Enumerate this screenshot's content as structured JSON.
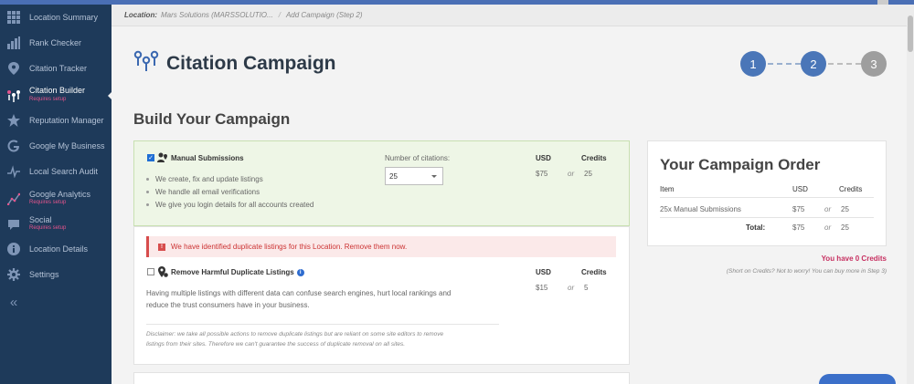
{
  "sidebar": {
    "items": [
      {
        "label": "Location Summary",
        "icon": "grid-icon",
        "sub": ""
      },
      {
        "label": "Rank Checker",
        "icon": "bar-chart-icon",
        "sub": ""
      },
      {
        "label": "Citation Tracker",
        "icon": "map-pin-icon",
        "sub": ""
      },
      {
        "label": "Citation Builder",
        "icon": "multi-pin-icon",
        "sub": "Requires setup",
        "active": true
      },
      {
        "label": "Reputation Manager",
        "icon": "star-icon",
        "sub": ""
      },
      {
        "label": "Google My Business",
        "icon": "google-icon",
        "sub": ""
      },
      {
        "label": "Local Search Audit",
        "icon": "pulse-icon",
        "sub": ""
      },
      {
        "label": "Google Analytics",
        "icon": "analytics-icon",
        "sub": "Requires setup"
      },
      {
        "label": "Social",
        "icon": "chat-bubble-icon",
        "sub": "Requires setup"
      },
      {
        "label": "Location Details",
        "icon": "info-icon",
        "sub": ""
      },
      {
        "label": "Settings",
        "icon": "gear-icon",
        "sub": ""
      }
    ],
    "collapse_icon": "double-chevron-left-icon",
    "collapse_glyph": "«"
  },
  "breadcrumb": {
    "label": "Location:",
    "location": "Mars Solutions (MARSSOLUTIO...",
    "separator": "/",
    "current": "Add Campaign (Step 2)"
  },
  "page": {
    "title": "Citation Campaign",
    "section_title": "Build Your Campaign"
  },
  "steps": {
    "items": [
      "1",
      "2",
      "3"
    ],
    "active_color": "#4a76b8",
    "inactive_color": "#9e9e9e"
  },
  "manual": {
    "title": "Manual Submissions",
    "checked": true,
    "bullets": [
      "We create, fix and update listings",
      "We handle all email verifications",
      "We give you login details for all accounts created"
    ],
    "number_label": "Number of citations:",
    "number_value": "25",
    "usd_header": "USD",
    "credits_header": "Credits",
    "usd_value": "$75",
    "or": "or",
    "credits_value": "25"
  },
  "alert": {
    "text": "We have identified duplicate listings for this Location. Remove them now.",
    "icon_glyph": "!"
  },
  "duplicates": {
    "title": "Remove Harmful Duplicate Listings",
    "checked": false,
    "description_1": "Having multiple listings with different data can confuse search engines, hurt local rankings and",
    "description_2": "reduce the trust consumers have in your business.",
    "disclaimer_1": "Disclaimer: we take all possible actions to remove duplicate listings but are reliant on some site editors to remove",
    "disclaimer_2": "listings from their sites. Therefore we can't guarantee the success of duplicate removal on all sites.",
    "usd_header": "USD",
    "credits_header": "Credits",
    "usd_value": "$15",
    "or": "or",
    "credits_value": "5",
    "info_glyph": "i"
  },
  "order": {
    "title": "Your Campaign Order",
    "col_item": "Item",
    "col_usd": "USD",
    "col_credits": "Credits",
    "row_item": "25x Manual Submissions",
    "row_usd": "$75",
    "row_or": "or",
    "row_credits": "25",
    "total_label": "Total:",
    "total_usd": "$75",
    "total_or": "or",
    "total_credits": "25"
  },
  "credits": {
    "message": "You have 0 Credits",
    "note": "(Short on Credits? Not to worry! You can buy more in Step 3)"
  },
  "colors": {
    "sidebar": "#1e3a5a",
    "accent": "#4a6fb5",
    "alert": "#d74c4c",
    "credits": "#c73061"
  }
}
